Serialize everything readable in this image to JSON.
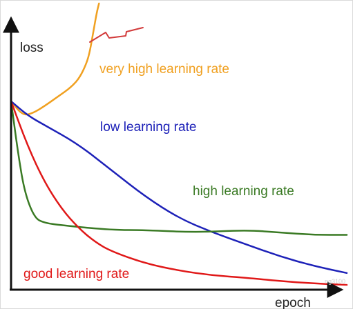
{
  "chart_data": {
    "type": "line",
    "xlabel": "epoch",
    "ylabel": "loss",
    "grid": false,
    "series": [
      {
        "name": "very high learning rate",
        "color": "#f0a020",
        "points": [
          [
            0,
            0.79
          ],
          [
            0.035,
            0.73
          ],
          [
            0.065,
            0.74
          ],
          [
            0.1,
            0.77
          ],
          [
            0.14,
            0.81
          ],
          [
            0.18,
            0.85
          ],
          [
            0.205,
            0.89
          ],
          [
            0.225,
            0.95
          ],
          [
            0.235,
            1.0
          ],
          [
            0.245,
            1.08
          ],
          [
            0.255,
            1.16
          ],
          [
            0.262,
            1.2
          ]
        ]
      },
      {
        "name": "low learning rate",
        "color": "#1d21b8",
        "points": [
          [
            0,
            0.79
          ],
          [
            0.05,
            0.73
          ],
          [
            0.1,
            0.69
          ],
          [
            0.2,
            0.61
          ],
          [
            0.3,
            0.5
          ],
          [
            0.4,
            0.39
          ],
          [
            0.5,
            0.3
          ],
          [
            0.6,
            0.24
          ],
          [
            0.7,
            0.19
          ],
          [
            0.8,
            0.14
          ],
          [
            0.9,
            0.1
          ],
          [
            1.0,
            0.07
          ]
        ]
      },
      {
        "name": "high learning rate",
        "color": "#3a7a24",
        "points": [
          [
            0,
            0.79
          ],
          [
            0.02,
            0.58
          ],
          [
            0.04,
            0.41
          ],
          [
            0.07,
            0.3
          ],
          [
            0.1,
            0.28
          ],
          [
            0.15,
            0.27
          ],
          [
            0.3,
            0.25
          ],
          [
            0.4,
            0.25
          ],
          [
            0.55,
            0.24
          ],
          [
            0.7,
            0.25
          ],
          [
            0.8,
            0.24
          ],
          [
            0.9,
            0.23
          ],
          [
            1.0,
            0.23
          ]
        ]
      },
      {
        "name": "good learning rate",
        "color": "#e01818",
        "points": [
          [
            0,
            0.79
          ],
          [
            0.05,
            0.6
          ],
          [
            0.1,
            0.45
          ],
          [
            0.15,
            0.34
          ],
          [
            0.2,
            0.26
          ],
          [
            0.25,
            0.2
          ],
          [
            0.3,
            0.16
          ],
          [
            0.4,
            0.11
          ],
          [
            0.5,
            0.08
          ],
          [
            0.6,
            0.06
          ],
          [
            0.7,
            0.05
          ],
          [
            0.85,
            0.03
          ],
          [
            1.0,
            0.02
          ]
        ]
      }
    ],
    "watermark": "ng3100"
  }
}
